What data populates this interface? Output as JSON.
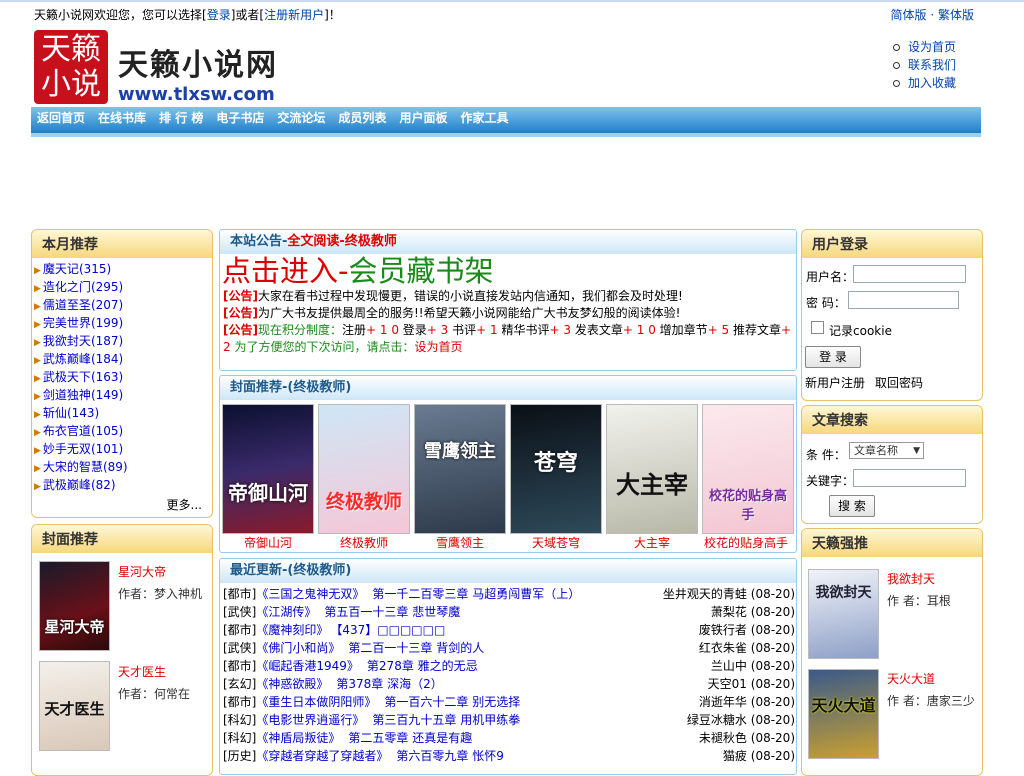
{
  "header": {
    "welcome_prefix": "天籁小说网欢迎您，您可以选择[",
    "login_link": "登录",
    "welcome_mid": "]或者[",
    "register_link": "注册新用户",
    "welcome_suffix": "]！",
    "lang_simplified": "简体版",
    "lang_sep": " · ",
    "lang_traditional": "繁体版",
    "logo_glyphs": [
      "天籁",
      "小说"
    ],
    "site_name": "天籁小说网",
    "site_url": "www.tlxsw.com",
    "top_links": [
      "设为首页",
      "联系我们",
      "加入收藏"
    ]
  },
  "nav": [
    "返回首页",
    "在线书库",
    "排 行 榜",
    "电子书店",
    "交流论坛",
    "成员列表",
    "用户面板",
    "作家工具"
  ],
  "monthly": {
    "title": "本月推荐",
    "items": [
      {
        "name": "魔天记",
        "count": "(315)"
      },
      {
        "name": "造化之门",
        "count": "(295)"
      },
      {
        "name": "儒道至圣",
        "count": "(207)"
      },
      {
        "name": "完美世界",
        "count": "(199)"
      },
      {
        "name": "我欲封天",
        "count": "(187)"
      },
      {
        "name": "武炼巅峰",
        "count": "(184)"
      },
      {
        "name": "武极天下",
        "count": "(163)"
      },
      {
        "name": "剑道独神",
        "count": "(149)"
      },
      {
        "name": "斩仙",
        "count": "(143)"
      },
      {
        "name": "布衣官道",
        "count": "(105)"
      },
      {
        "name": "妙手无双",
        "count": "(101)"
      },
      {
        "name": "大宋的智慧",
        "count": "(89)"
      },
      {
        "name": "武极巅峰",
        "count": "(82)"
      }
    ],
    "more": "更多..."
  },
  "left_cover": {
    "title": "封面推荐",
    "books": [
      {
        "name": "星河大帝",
        "author": "作者：梦入神机",
        "cover_text": "星河大帝"
      },
      {
        "name": "天才医生",
        "author": "作者：何常在",
        "cover_text": "天才医生"
      }
    ]
  },
  "notice": {
    "title_prefix": "本站公告-",
    "title_link": "全文阅读",
    "title_suffix": "-终极教师",
    "big_red": "点击进入-",
    "big_green": "会员藏书架",
    "tag": "[公告]",
    "line1": "大家在看书过程中发现慢更，错误的小说直接发站内信通知，我们都会及时处理!",
    "line2": "为广大书友提供最周全的服务!!希望天籁小说网能给广大书友梦幻般的阅读体验!",
    "line3_a": "现在积分制度：",
    "line3_b": "注册",
    "line3_c": "+ 1 0",
    "line3_d": "登录",
    "line3_e": "+ 3",
    "line3_f": "书评",
    "line3_g": "+ 1",
    "line3_h": "精华书评",
    "line3_i": "+ 3",
    "line3_j": "发表文章",
    "line3_k": "+ 1 0",
    "line3_l": "增加章节",
    "line3_m": "+ 5",
    "line3_n": "推荐文章",
    "line3_o": "+ 2",
    "line3_p": "为了方便您的下次访问，请点击：",
    "line3_q": "设为首页"
  },
  "cover_rec": {
    "title": "封面推荐-(终极教师)",
    "books": [
      {
        "name": "帝御山河",
        "cover_text": "帝御山河"
      },
      {
        "name": "终极教师",
        "cover_text": "终极教师"
      },
      {
        "name": "雪鹰领主",
        "cover_text": "雪鹰领主"
      },
      {
        "name": "天域苍穹",
        "cover_text": "苍穹"
      },
      {
        "name": "大主宰",
        "cover_text": "大主宰"
      },
      {
        "name": "校花的贴身高手",
        "cover_text": "校花的贴身高手"
      }
    ]
  },
  "updates": {
    "title": "最近更新-(终极教师)",
    "rows": [
      {
        "cat": "[都市]",
        "book": "《三国之鬼神无双》",
        "chapter": "第一千二百零三章 马超勇闯曹军（上）",
        "author": "坐井观天的青蛙",
        "date": "(08-20)"
      },
      {
        "cat": "[武侠]",
        "book": "《江湖传》",
        "chapter": "第五百一十三章 悲世琴魔",
        "author": "萧梨花",
        "date": "(08-20)"
      },
      {
        "cat": "[都市]",
        "book": "《魔神刻印》",
        "chapter": "【437】□□□□□□",
        "author": "废铁行者",
        "date": "(08-20)"
      },
      {
        "cat": "[武侠]",
        "book": "《佛门小和尚》",
        "chapter": "第二百一十三章 背剑的人",
        "author": "红衣朱雀",
        "date": "(08-20)"
      },
      {
        "cat": "[都市]",
        "book": "《崛起香港1949》",
        "chapter": "第278章 雅之的无忌",
        "author": "兰山中",
        "date": "(08-20)"
      },
      {
        "cat": "[玄幻]",
        "book": "《神惑欲殿》",
        "chapter": "第378章 深海（2）",
        "author": "天空01",
        "date": "(08-20)"
      },
      {
        "cat": "[都市]",
        "book": "《重生日本做阴阳师》",
        "chapter": "第一百六十二章 别无选择",
        "author": "消逝年华",
        "date": "(08-20)"
      },
      {
        "cat": "[科幻]",
        "book": "《电影世界逍遥行》",
        "chapter": "第三百九十五章 用机甲练拳",
        "author": "绿豆冰糖水",
        "date": "(08-20)"
      },
      {
        "cat": "[科幻]",
        "book": "《神盾局叛徒》",
        "chapter": "第二五零章 还真是有趣",
        "author": "未褪秋色",
        "date": "(08-20)"
      },
      {
        "cat": "[历史]",
        "book": "《穿越者穿越了穿越者》",
        "chapter": "第六百零九章 怅怀9",
        "author": "猫疲",
        "date": "(08-20)"
      }
    ]
  },
  "login": {
    "title": "用户登录",
    "user_label": "用户名：",
    "pass_label": "密  码：",
    "remember": "记录cookie",
    "submit": "登 录",
    "register": "新用户注册",
    "recover": "取回密码"
  },
  "search": {
    "title": "文章搜索",
    "cond_label": "条  件：",
    "cond_value": "文章名称",
    "kw_label": "关键字：",
    "submit": "搜 索"
  },
  "strong": {
    "title": "天籁强推",
    "books": [
      {
        "name": "我欲封天",
        "author": "作 者：耳根",
        "cover_text": "我欲封天"
      },
      {
        "name": "天火大道",
        "author": "作 者：唐家三少",
        "cover_text": "天火大道"
      }
    ]
  },
  "colors": {
    "nav_blue": "#1f7ec6",
    "accent_red": "#dd0000",
    "accent_green": "#1a8a1a",
    "box_border": "#e8c26a"
  }
}
